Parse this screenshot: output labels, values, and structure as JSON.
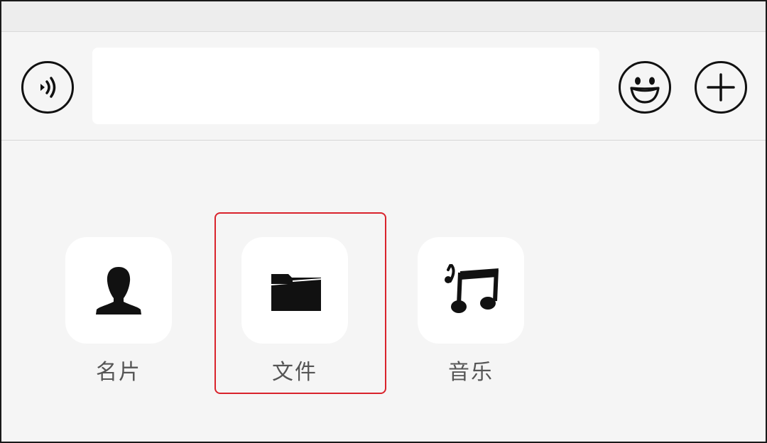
{
  "top_bar": {},
  "input_bar": {
    "voice_icon": "voice-icon",
    "text_value": "",
    "emoji_icon": "smiley-icon",
    "plus_icon": "plus-icon"
  },
  "attachments": {
    "items": [
      {
        "label": "名片",
        "icon": "contact-card-icon"
      },
      {
        "label": "文件",
        "icon": "folder-icon"
      },
      {
        "label": "音乐",
        "icon": "music-note-icon"
      }
    ],
    "highlight_color": "#d9232c"
  }
}
